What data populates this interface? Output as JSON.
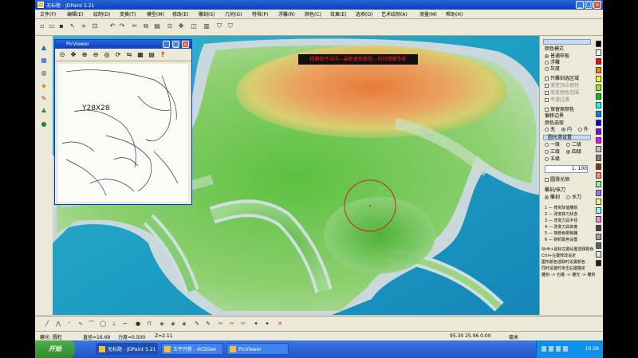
{
  "window": {
    "title": "无标题 - JDPaint 5.21"
  },
  "menu": [
    "文件(F)",
    "编辑(E)",
    "绘制(D)",
    "变换(T)",
    "模型(M)",
    "修改(E)",
    "雕刻(S)",
    "几何(G)",
    "特殊(P)",
    "浮雕(R)",
    "颜色(C)",
    "效果(E)",
    "选项(O)",
    "艺术绘制(A)",
    "测量(M)",
    "帮助(H)"
  ],
  "viewer": {
    "title": "PicViewer",
    "sketch_label": "Y28X28"
  },
  "banner": {
    "text": "精雕软件培训---最新更新教程---你的精雕专家"
  },
  "panel": {
    "group1_title": "颜色模式",
    "opt_smooth": "普通样板",
    "opt_relief": "浮雕",
    "opt_surface": "灰度",
    "chk_brush": "只雕刻选区域",
    "chk_gradient": "渐变顶点保持",
    "chk_range": "渐变颜色范围",
    "chk_seam": "平滑过渡",
    "chk_merge": "保留原颜色",
    "chk_boundary": "偏移边界",
    "group2_title": "颜色选取",
    "dir_none": "无",
    "dir_in": "内",
    "dir_out": "外",
    "group3_title": "圆光滑设置",
    "lvl_1": "一级",
    "lvl_2": "二级",
    "lvl_3": "三级",
    "lvl_4": "四级",
    "lvl_5": "五级",
    "value": "1. 100",
    "chk_smooth_angle": "圆滑光顺",
    "group4_title": "雕刻/抹刀",
    "opt_carve": "雕刻",
    "opt_smear": "水刀",
    "hints": [
      "1 — 按实际值雕刻",
      "2 — 改变抹刀状态",
      "3 — 改变刀具半径",
      "4 — 改变刀具高度",
      "5 — 按颜色限制雕",
      "6 — 随机取色设置"
    ],
    "notes": [
      "Shift+鼠标左键设置选择颜色",
      "Ctrl+左键修改设定",
      "图形颜色选取时设置颜色",
      "同时设置时单击右键确定",
      "雕刻 -> 右键 -> 雕光 -> 雕刻"
    ]
  },
  "palette": [
    "#000000",
    "#ffffff",
    "#ff0000",
    "#ff8000",
    "#ffff00",
    "#80ff00",
    "#00c000",
    "#00ffff",
    "#0080ff",
    "#0000ff",
    "#8000ff",
    "#ff00ff",
    "#c0c0c0",
    "#808080",
    "#804000",
    "#ff8080",
    "#80ff80",
    "#8080ff",
    "#ffff80",
    "#80ffff",
    "#ff80ff",
    "#404040",
    "#a0a0a0",
    "#606060",
    "#e0e0e0",
    "#202020"
  ],
  "status": {
    "tool": "磨光: 圆柱",
    "diameter": "直径=16.69",
    "force": "力度=0.500",
    "z": "Z=2.11",
    "coords": "95.30  25.96  0.00",
    "mode": "毫米"
  },
  "taskbar": {
    "start": "开始",
    "tasks": [
      "无标题 - JDPaint 5.21",
      "王平开新 - ACDSee",
      "PicViewer"
    ],
    "clock": "10:28"
  }
}
